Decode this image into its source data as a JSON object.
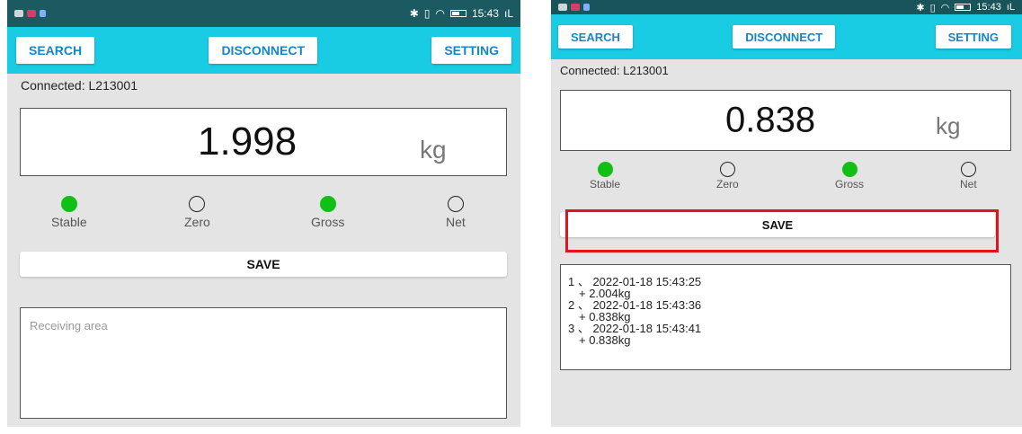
{
  "left": {
    "statusbar": {
      "time": "15:43",
      "signal": "ıL"
    },
    "toolbar": {
      "search": "SEARCH",
      "disconnect": "DISCONNECT",
      "setting": "SETTING"
    },
    "connected": "Connected:  L213001",
    "weight": {
      "value": "1.998",
      "unit": "kg"
    },
    "indicators": [
      {
        "label": "Stable",
        "on": true
      },
      {
        "label": "Zero",
        "on": false
      },
      {
        "label": "Gross",
        "on": true
      },
      {
        "label": "Net",
        "on": false
      }
    ],
    "save": "SAVE",
    "receive_placeholder": "Receiving area"
  },
  "right": {
    "statusbar": {
      "time": "15:43",
      "signal": "ıL"
    },
    "toolbar": {
      "search": "SEARCH",
      "disconnect": "DISCONNECT",
      "setting": "SETTING"
    },
    "connected": "Connected:  L213001",
    "weight": {
      "value": "0.838",
      "unit": "kg"
    },
    "indicators": [
      {
        "label": "Stable",
        "on": true
      },
      {
        "label": "Zero",
        "on": false
      },
      {
        "label": "Gross",
        "on": true
      },
      {
        "label": "Net",
        "on": false
      }
    ],
    "save": "SAVE",
    "log": [
      {
        "line1": "1 、 2022-01-18 15:43:25",
        "line2": "+ 2.004kg"
      },
      {
        "line1": "2 、 2022-01-18 15:43:36",
        "line2": "+ 0.838kg"
      },
      {
        "line1": "3 、 2022-01-18 15:43:41",
        "line2": "+ 0.838kg"
      }
    ]
  },
  "colors": {
    "toolbar": "#19cbe3",
    "button_text": "#1486c9",
    "indicator_on": "#11c015",
    "highlight": "#e0141d",
    "statusbar": "#1c5a61"
  }
}
